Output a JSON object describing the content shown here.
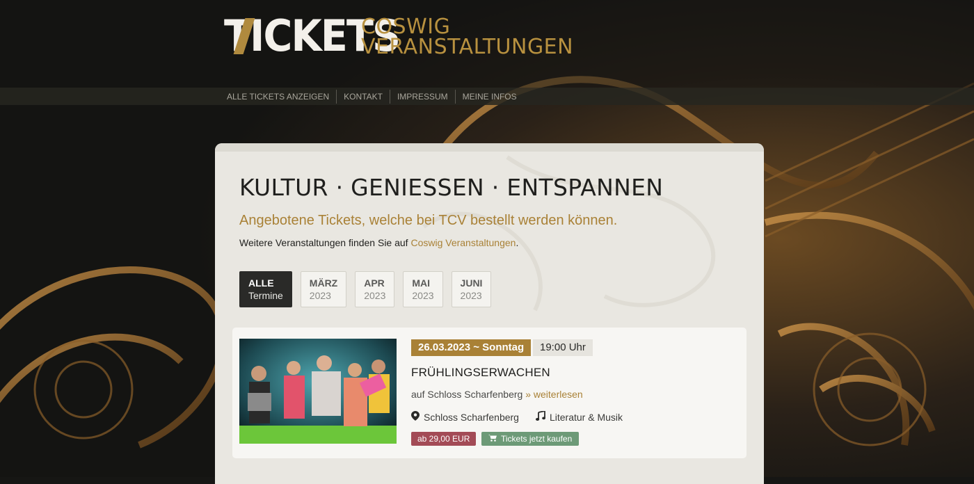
{
  "brand": {
    "logo_word": "TICKETS",
    "logo_sub_1": "COSWIG",
    "logo_sub_2": "VERANSTALTUNGEN"
  },
  "nav": {
    "items": [
      {
        "label": "ALLE TICKETS ANZEIGEN"
      },
      {
        "label": "KONTAKT"
      },
      {
        "label": "IMPRESSUM"
      },
      {
        "label": "MEINE INFOS"
      }
    ]
  },
  "main": {
    "headline": "KULTUR · GENIESSEN · ENTSPANNEN",
    "subhead": "Angebotene Tickets, welche bei TCV bestellt werden können.",
    "info_prefix": "Weitere Veranstaltungen finden Sie auf ",
    "info_link": "Coswig Veranstaltungen",
    "info_suffix": "."
  },
  "months": [
    {
      "label": "ALLE",
      "sub": "Termine",
      "active": true
    },
    {
      "label": "MÄRZ",
      "sub": "2023",
      "active": false
    },
    {
      "label": "APR",
      "sub": "2023",
      "active": false
    },
    {
      "label": "MAI",
      "sub": "2023",
      "active": false
    },
    {
      "label": "JUNI",
      "sub": "2023",
      "active": false
    }
  ],
  "event": {
    "date": "26.03.2023 ~ Sonntag",
    "time": "19:00 Uhr",
    "title": "FRÜHLINGSERWACHEN",
    "subtitle": "auf Schloss Scharfenberg",
    "more": "» weiterlesen",
    "location": "Schloss Scharfenberg",
    "category": "Literatur & Musik",
    "price": "ab 29,00 EUR",
    "buy": "Tickets jetzt kaufen"
  },
  "colors": {
    "gold": "#a98136",
    "dark": "#1f1f1d",
    "price_badge": "#a34b56",
    "buy_button": "#6d9a77"
  },
  "icons": {
    "location": "map-marker-icon",
    "category": "music-note-icon",
    "cart": "cart-icon"
  }
}
